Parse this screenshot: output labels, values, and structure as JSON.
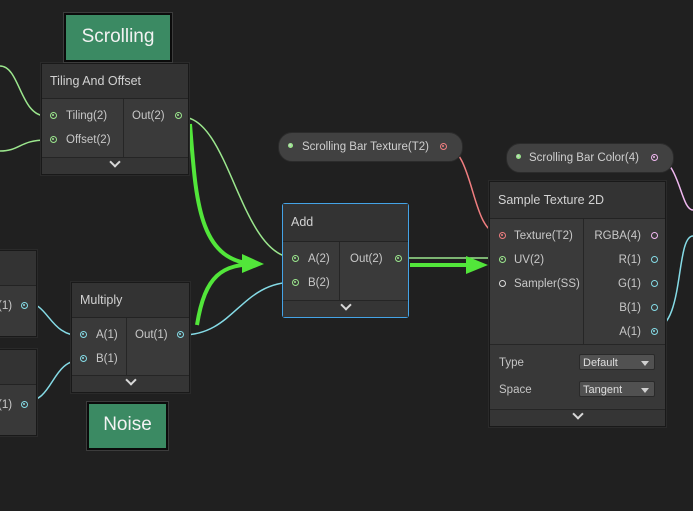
{
  "labels": {
    "scrolling": "Scrolling",
    "noise": "Noise"
  },
  "tiling_node": {
    "title": "Tiling And Offset",
    "inputs": [
      "Tiling(2)",
      "Offset(2)"
    ],
    "output": "Out(2)"
  },
  "multiply_node": {
    "title": "Multiply",
    "inputs": [
      "A(1)",
      "B(1)"
    ],
    "output": "Out(1)"
  },
  "add_node": {
    "title": "Add",
    "inputs": [
      "A(2)",
      "B(2)"
    ],
    "output": "Out(2)"
  },
  "left_stubs": {
    "top_out": "(1)",
    "bottom_out": "(1)"
  },
  "properties": {
    "texture": "Scrolling Bar Texture(T2)",
    "color": "Scrolling Bar Color(4)"
  },
  "sample_node": {
    "title": "Sample Texture 2D",
    "inputs": [
      "Texture(T2)",
      "UV(2)",
      "Sampler(SS)"
    ],
    "outputs": [
      "RGBA(4)",
      "R(1)",
      "G(1)",
      "B(1)",
      "A(1)"
    ],
    "type_label": "Type",
    "type_value": "Default",
    "space_label": "Space",
    "space_value": "Tangent"
  },
  "colors": {
    "vec2": "#9be68d",
    "vec1": "#85dbe6",
    "texture": "#f07e80",
    "vec4": "#f0b8f0",
    "sampler": "#dddddd",
    "highlight_arrow": "#52e63a",
    "selection": "#44a3e6"
  },
  "icons": [
    "chevron-down-icon",
    "arrow-icon",
    "port-dot-icon"
  ]
}
